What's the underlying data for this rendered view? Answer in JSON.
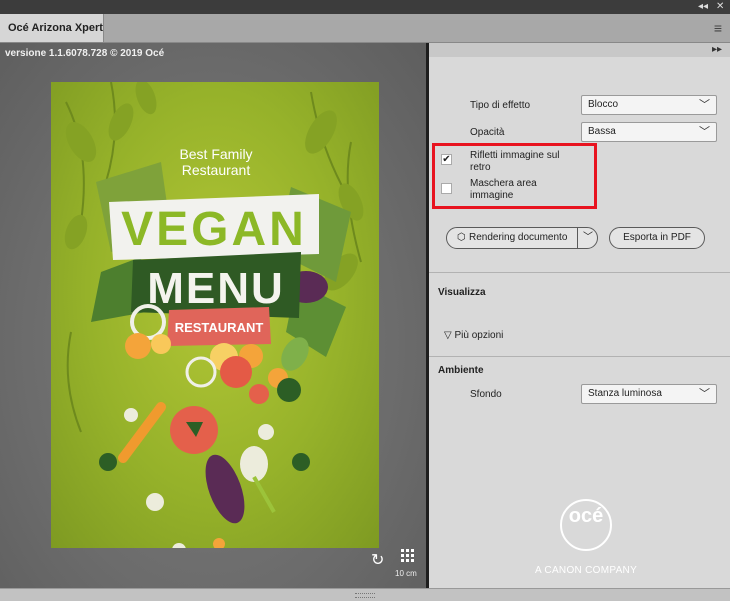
{
  "window": {
    "tab_title": "Océ Arizona Xpert",
    "collapse_icon": "double-chevron-left-icon",
    "close_icon": "close-icon",
    "menu_icon": "hamburger-menu-icon"
  },
  "preview": {
    "version_text": "versione 1.1.6078.728 © 2019 Océ",
    "poster": {
      "line1": "Best Family",
      "line2": "Restaurant",
      "vegan": "VEGAN",
      "menu": "MENU",
      "restaurant": "RESTAURANT"
    },
    "scale_label": "10 cm"
  },
  "panel": {
    "effect_type": {
      "label": "Tipo di effetto",
      "value": "Blocco"
    },
    "opacity": {
      "label": "Opacità",
      "value": "Bassa"
    },
    "reflect": {
      "label_line1": "Rifletti immagine sul",
      "label_line2": "retro",
      "checked": true,
      "mark": "✔"
    },
    "mask": {
      "label_line1": "Maschera area",
      "label_line2": "immagine",
      "checked": false
    },
    "render_button": "Rendering documento",
    "export_button": "Esporta in PDF",
    "visualizza": {
      "title": "Visualizza",
      "more_options": "Più opzioni"
    },
    "ambiente": {
      "title": "Ambiente",
      "background_label": "Sfondo",
      "background_value": "Stanza luminosa"
    },
    "logo": {
      "brand": "océ",
      "tagline": "A CANON COMPANY"
    }
  },
  "colors": {
    "highlight": "#e8131f",
    "poster_green": "#9bb52c",
    "menu_green": "#2f5a24",
    "restaurant_red": "#e0655a"
  }
}
